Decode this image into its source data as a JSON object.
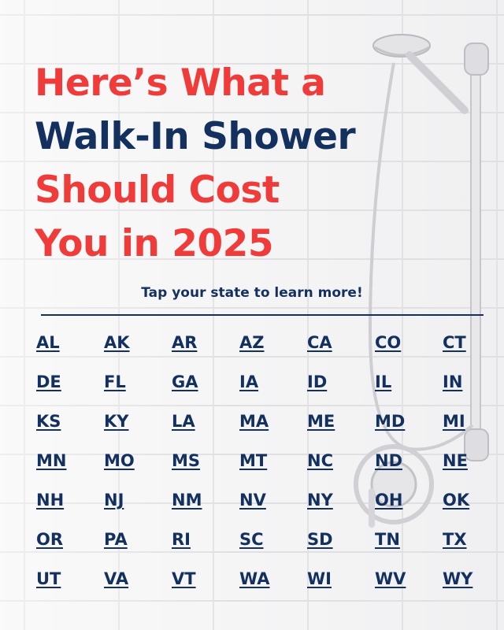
{
  "headline": {
    "line1": "Here’s What a",
    "line2": "Walk-In Shower",
    "line3": "Should Cost",
    "line4": "You in 2025"
  },
  "tagline": "Tap your state to learn more!",
  "colors": {
    "red": "#ef3b39",
    "navy": "#13305f",
    "background": "#f3f3f4"
  },
  "states": [
    "AL",
    "AK",
    "AR",
    "AZ",
    "CA",
    "CO",
    "CT",
    "DE",
    "FL",
    "GA",
    "IA",
    "ID",
    "IL",
    "IN",
    "KS",
    "KY",
    "LA",
    "MA",
    "ME",
    "MD",
    "MI",
    "MN",
    "MO",
    "MS",
    "MT",
    "NC",
    "ND",
    "NE",
    "NH",
    "NJ",
    "NM",
    "NV",
    "NY",
    "OH",
    "OK",
    "OR",
    "PA",
    "RI",
    "SC",
    "SD",
    "TN",
    "TX",
    "UT",
    "VA",
    "VT",
    "WA",
    "WI",
    "WV",
    "WY"
  ]
}
